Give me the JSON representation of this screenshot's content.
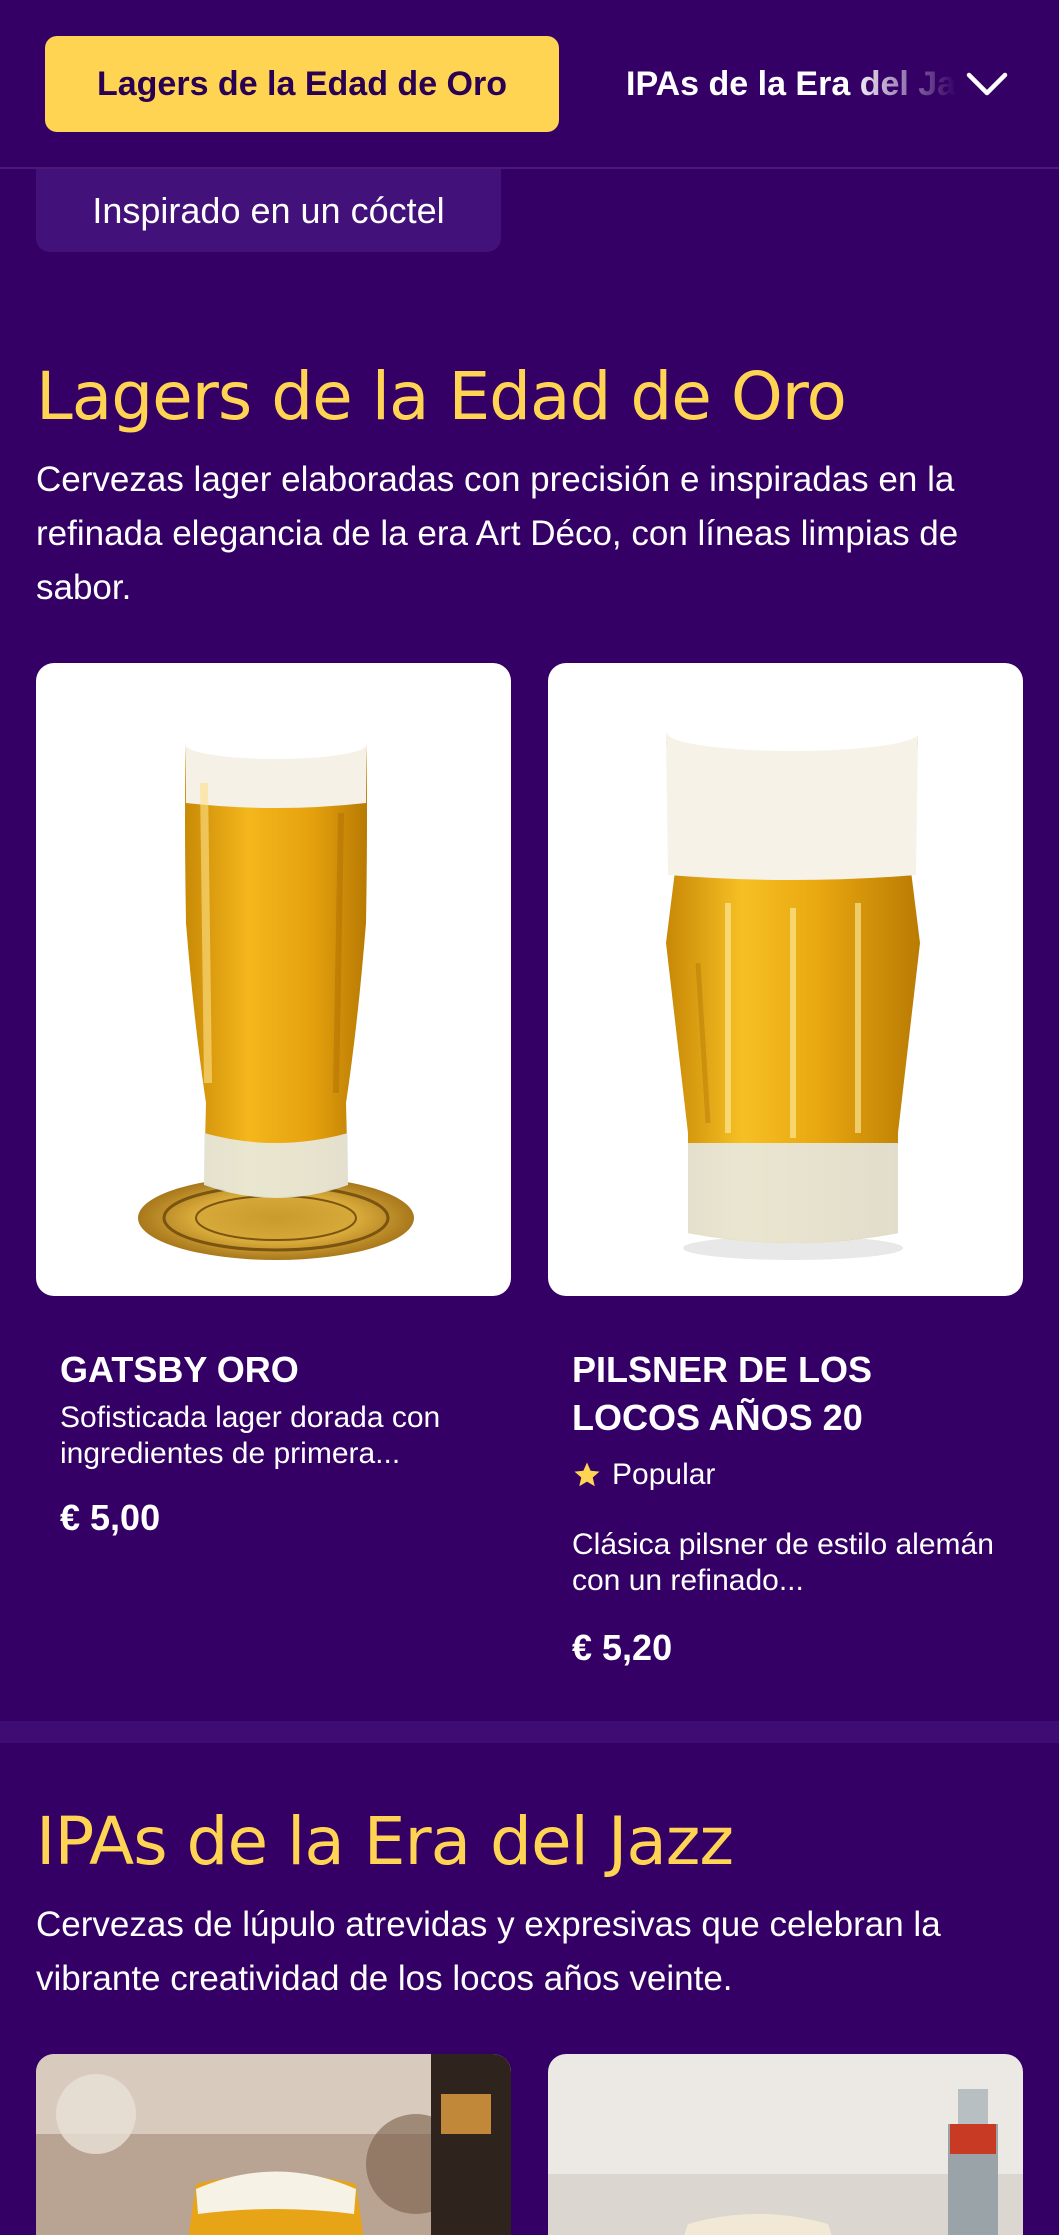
{
  "nav": {
    "active_tab": "Lagers de la Edad de Oro",
    "next_tab": "IPAs de la Era del Jazz",
    "expand_icon": "chevron-down-icon"
  },
  "filter_chip": "Inspirado en un cóctel",
  "sections": [
    {
      "title": "Lagers de la Edad de Oro",
      "description": "Cervezas lager elaboradas con precisión e inspiradas en la refinada elegancia de la era Art Déco, con líneas limpias de sabor.",
      "products": [
        {
          "name": "Gatsby Oro",
          "description": "Sofisticada lager dorada con ingredientes de primera...",
          "price": "€ 5,00"
        },
        {
          "name": "Pilsner de los Locos Años 20",
          "badge": "Popular",
          "badge_icon": "star-icon",
          "description": "Clásica pilsner de estilo alemán con un refinado...",
          "price": "€ 5,20"
        }
      ]
    },
    {
      "title": "IPAs de la Era del Jazz",
      "description": "Cervezas de lúpulo atrevidas y expresivas que celebran la vibrante creatividad de los locos años veinte."
    }
  ],
  "colors": {
    "background": "#350066",
    "accent": "#ffd452",
    "divider": "#3f0c74"
  }
}
